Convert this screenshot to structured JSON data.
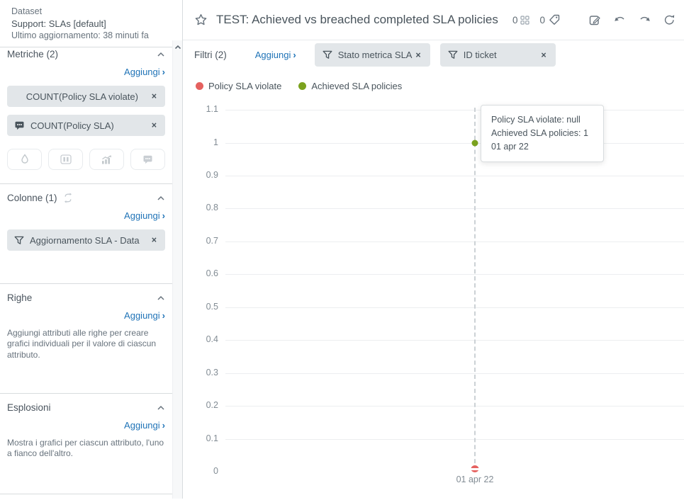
{
  "sidebar": {
    "dataset": {
      "label": "Dataset",
      "name": "Support: SLAs [default]",
      "updated": "Ultimo aggiornamento: 38 minuti fa"
    },
    "metrics": {
      "title": "Metriche (2)",
      "add_label": "Aggiungi",
      "chips": [
        {
          "label": "COUNT(Policy SLA violate)",
          "remove_label": "×"
        },
        {
          "label": "COUNT(Policy SLA)",
          "icon": "chat-icon",
          "remove_label": "×"
        }
      ]
    },
    "columns": {
      "title": "Colonne (1)",
      "add_label": "Aggiungi",
      "chips": [
        {
          "label": "Aggiornamento SLA - Data",
          "icon": "funnel-icon",
          "remove_label": "×"
        }
      ]
    },
    "rows": {
      "title": "Righe",
      "add_label": "Aggiungi",
      "description": "Aggiungi attributi alle righe per creare grafici individuali per il valore di ciascun attributo."
    },
    "explosions": {
      "title": "Esplosioni",
      "add_label": "Aggiungi",
      "description": "Mostra i grafici per ciascun attributo, l'uno a fianco dell'altro."
    }
  },
  "header": {
    "title": "TEST: Achieved vs breached completed SLA policies",
    "dashboards_count": "0",
    "tags_count": "0"
  },
  "filters": {
    "title": "Filtri (2)",
    "add_label": "Aggiungi",
    "chips": [
      {
        "label": "Stato metrica SLA",
        "remove_label": "×"
      },
      {
        "label": "ID ticket",
        "remove_label": "×"
      }
    ]
  },
  "colors": {
    "link": "#1f73b7",
    "chip_bg": "#e2e6e9"
  },
  "chart_data": {
    "type": "scatter",
    "x": [
      "01 apr 22"
    ],
    "series": [
      {
        "name": "Policy SLA violate",
        "color": "#e5615f",
        "values": [
          0
        ],
        "value_label": "null"
      },
      {
        "name": "Achieved SLA policies",
        "color": "#7ba21e",
        "values": [
          1
        ],
        "value_label": "1"
      }
    ],
    "ylim": [
      0,
      1.1
    ],
    "ytick_labels": [
      "1.1",
      "1",
      "0.9",
      "0.8",
      "0.7",
      "0.6",
      "0.5",
      "0.4",
      "0.3",
      "0.2",
      "0.1",
      "0"
    ],
    "ytick_values": [
      1.1,
      1,
      0.9,
      0.8,
      0.7,
      0.6,
      0.5,
      0.4,
      0.3,
      0.2,
      0.1,
      0
    ],
    "grid": "horizontal",
    "legend_position": "top-left",
    "tooltip": {
      "lines": [
        "Policy SLA violate: null",
        "Achieved SLA policies: 1",
        "01 apr 22"
      ]
    }
  }
}
